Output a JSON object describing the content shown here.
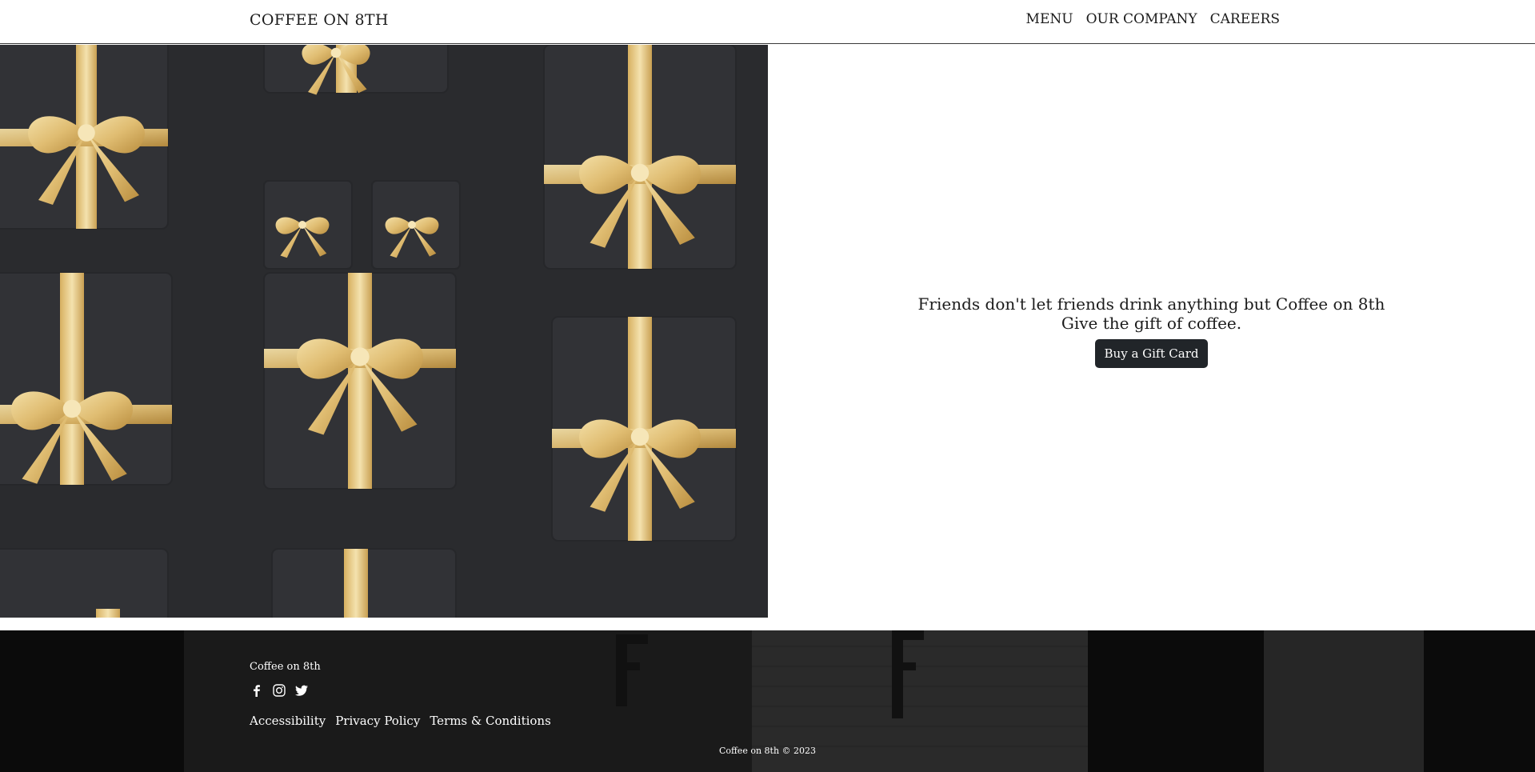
{
  "nav": {
    "brand": "COFFEE ON 8TH",
    "links": [
      "MENU",
      "OUR COMPANY",
      "CAREERS"
    ]
  },
  "hero": {
    "headline": "Friends don't let friends drink anything but Coffee on 8th",
    "subline": "Give the gift of coffee.",
    "button_label": "Buy a Gift Card",
    "image_icon": "gift-boxes-image"
  },
  "footer": {
    "name": "Coffee on 8th",
    "social_icons": [
      "facebook-icon",
      "instagram-icon",
      "twitter-icon"
    ],
    "links": [
      "Accessibility",
      "Privacy Policy",
      "Terms & Conditions"
    ],
    "copyright": "Coffee on 8th © 2023"
  },
  "colors": {
    "button_bg": "#212529",
    "ribbon_gold": "#e3c27a",
    "box_dark": "#2b2c2f",
    "footer_bg": "#0c0c0c"
  }
}
